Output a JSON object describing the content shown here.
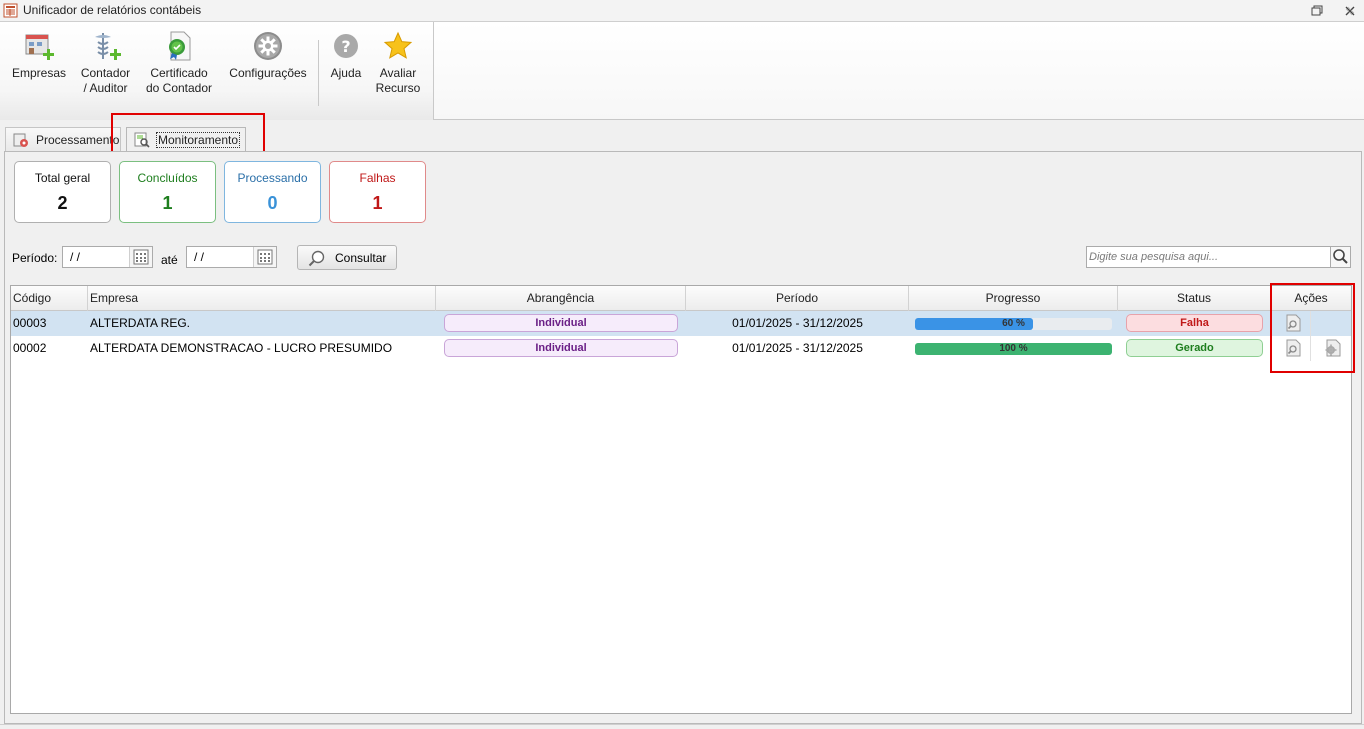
{
  "window": {
    "title": "Unificador de relatórios contábeis"
  },
  "ribbon": {
    "empresas": "Empresas",
    "contador_l1": "Contador",
    "contador_l2": "/ Auditor",
    "certificado_l1": "Certificado",
    "certificado_l2": "do Contador",
    "configuracoes": "Configurações",
    "ajuda": "Ajuda",
    "avaliar_l1": "Avaliar",
    "avaliar_l2": "Recurso"
  },
  "tabs": {
    "processamento": "Processamento",
    "monitoramento": "Monitoramento"
  },
  "summary": {
    "total": {
      "label": "Total geral",
      "value": "2"
    },
    "concluidos": {
      "label": "Concluídos",
      "value": "1"
    },
    "processando": {
      "label": "Processando",
      "value": "0"
    },
    "falhas": {
      "label": "Falhas",
      "value": "1"
    }
  },
  "filter": {
    "periodo_label": "Período:",
    "date_from": "/ /",
    "ate_label": "até",
    "date_to": "/ /",
    "consultar": "Consultar",
    "search_placeholder": "Digite sua pesquisa aqui..."
  },
  "table": {
    "headers": {
      "codigo": "Código",
      "empresa": "Empresa",
      "abrangencia": "Abrangência",
      "periodo": "Período",
      "progresso": "Progresso",
      "status": "Status",
      "acoes": "Ações"
    },
    "rows": [
      {
        "codigo": "00003",
        "empresa": "ALTERDATA REG.",
        "abrangencia": "Individual",
        "periodo": "01/01/2025 - 31/12/2025",
        "progress_label": "60 %",
        "progress": 0.6,
        "status": "Falha"
      },
      {
        "codigo": "00002",
        "empresa": "ALTERDATA DEMONSTRACAO  - LUCRO PRESUMIDO",
        "abrangencia": "Individual",
        "periodo": "01/01/2025 - 31/12/2025",
        "progress_label": "100 %",
        "progress": 1.0,
        "status": "Gerado"
      }
    ]
  },
  "colors": {
    "progress_partial": "#3a93e6",
    "progress_full": "#3cb371",
    "highlight": "#e00000"
  }
}
